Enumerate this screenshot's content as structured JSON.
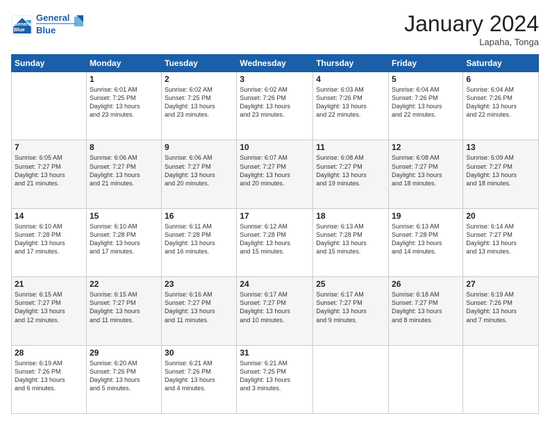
{
  "logo": {
    "line1": "General",
    "line2": "Blue"
  },
  "title": "January 2024",
  "location": "Lapaha, Tonga",
  "days_of_week": [
    "Sunday",
    "Monday",
    "Tuesday",
    "Wednesday",
    "Thursday",
    "Friday",
    "Saturday"
  ],
  "weeks": [
    [
      {
        "num": "",
        "info": ""
      },
      {
        "num": "1",
        "info": "Sunrise: 6:01 AM\nSunset: 7:25 PM\nDaylight: 13 hours\nand 23 minutes."
      },
      {
        "num": "2",
        "info": "Sunrise: 6:02 AM\nSunset: 7:25 PM\nDaylight: 13 hours\nand 23 minutes."
      },
      {
        "num": "3",
        "info": "Sunrise: 6:02 AM\nSunset: 7:26 PM\nDaylight: 13 hours\nand 23 minutes."
      },
      {
        "num": "4",
        "info": "Sunrise: 6:03 AM\nSunset: 7:26 PM\nDaylight: 13 hours\nand 22 minutes."
      },
      {
        "num": "5",
        "info": "Sunrise: 6:04 AM\nSunset: 7:26 PM\nDaylight: 13 hours\nand 22 minutes."
      },
      {
        "num": "6",
        "info": "Sunrise: 6:04 AM\nSunset: 7:26 PM\nDaylight: 13 hours\nand 22 minutes."
      }
    ],
    [
      {
        "num": "7",
        "info": "Sunrise: 6:05 AM\nSunset: 7:27 PM\nDaylight: 13 hours\nand 21 minutes."
      },
      {
        "num": "8",
        "info": "Sunrise: 6:06 AM\nSunset: 7:27 PM\nDaylight: 13 hours\nand 21 minutes."
      },
      {
        "num": "9",
        "info": "Sunrise: 6:06 AM\nSunset: 7:27 PM\nDaylight: 13 hours\nand 20 minutes."
      },
      {
        "num": "10",
        "info": "Sunrise: 6:07 AM\nSunset: 7:27 PM\nDaylight: 13 hours\nand 20 minutes."
      },
      {
        "num": "11",
        "info": "Sunrise: 6:08 AM\nSunset: 7:27 PM\nDaylight: 13 hours\nand 19 minutes."
      },
      {
        "num": "12",
        "info": "Sunrise: 6:08 AM\nSunset: 7:27 PM\nDaylight: 13 hours\nand 18 minutes."
      },
      {
        "num": "13",
        "info": "Sunrise: 6:09 AM\nSunset: 7:27 PM\nDaylight: 13 hours\nand 18 minutes."
      }
    ],
    [
      {
        "num": "14",
        "info": "Sunrise: 6:10 AM\nSunset: 7:28 PM\nDaylight: 13 hours\nand 17 minutes."
      },
      {
        "num": "15",
        "info": "Sunrise: 6:10 AM\nSunset: 7:28 PM\nDaylight: 13 hours\nand 17 minutes."
      },
      {
        "num": "16",
        "info": "Sunrise: 6:11 AM\nSunset: 7:28 PM\nDaylight: 13 hours\nand 16 minutes."
      },
      {
        "num": "17",
        "info": "Sunrise: 6:12 AM\nSunset: 7:28 PM\nDaylight: 13 hours\nand 15 minutes."
      },
      {
        "num": "18",
        "info": "Sunrise: 6:13 AM\nSunset: 7:28 PM\nDaylight: 13 hours\nand 15 minutes."
      },
      {
        "num": "19",
        "info": "Sunrise: 6:13 AM\nSunset: 7:28 PM\nDaylight: 13 hours\nand 14 minutes."
      },
      {
        "num": "20",
        "info": "Sunrise: 6:14 AM\nSunset: 7:27 PM\nDaylight: 13 hours\nand 13 minutes."
      }
    ],
    [
      {
        "num": "21",
        "info": "Sunrise: 6:15 AM\nSunset: 7:27 PM\nDaylight: 13 hours\nand 12 minutes."
      },
      {
        "num": "22",
        "info": "Sunrise: 6:15 AM\nSunset: 7:27 PM\nDaylight: 13 hours\nand 11 minutes."
      },
      {
        "num": "23",
        "info": "Sunrise: 6:16 AM\nSunset: 7:27 PM\nDaylight: 13 hours\nand 11 minutes."
      },
      {
        "num": "24",
        "info": "Sunrise: 6:17 AM\nSunset: 7:27 PM\nDaylight: 13 hours\nand 10 minutes."
      },
      {
        "num": "25",
        "info": "Sunrise: 6:17 AM\nSunset: 7:27 PM\nDaylight: 13 hours\nand 9 minutes."
      },
      {
        "num": "26",
        "info": "Sunrise: 6:18 AM\nSunset: 7:27 PM\nDaylight: 13 hours\nand 8 minutes."
      },
      {
        "num": "27",
        "info": "Sunrise: 6:19 AM\nSunset: 7:26 PM\nDaylight: 13 hours\nand 7 minutes."
      }
    ],
    [
      {
        "num": "28",
        "info": "Sunrise: 6:19 AM\nSunset: 7:26 PM\nDaylight: 13 hours\nand 6 minutes."
      },
      {
        "num": "29",
        "info": "Sunrise: 6:20 AM\nSunset: 7:26 PM\nDaylight: 13 hours\nand 5 minutes."
      },
      {
        "num": "30",
        "info": "Sunrise: 6:21 AM\nSunset: 7:26 PM\nDaylight: 13 hours\nand 4 minutes."
      },
      {
        "num": "31",
        "info": "Sunrise: 6:21 AM\nSunset: 7:25 PM\nDaylight: 13 hours\nand 3 minutes."
      },
      {
        "num": "",
        "info": ""
      },
      {
        "num": "",
        "info": ""
      },
      {
        "num": "",
        "info": ""
      }
    ]
  ]
}
